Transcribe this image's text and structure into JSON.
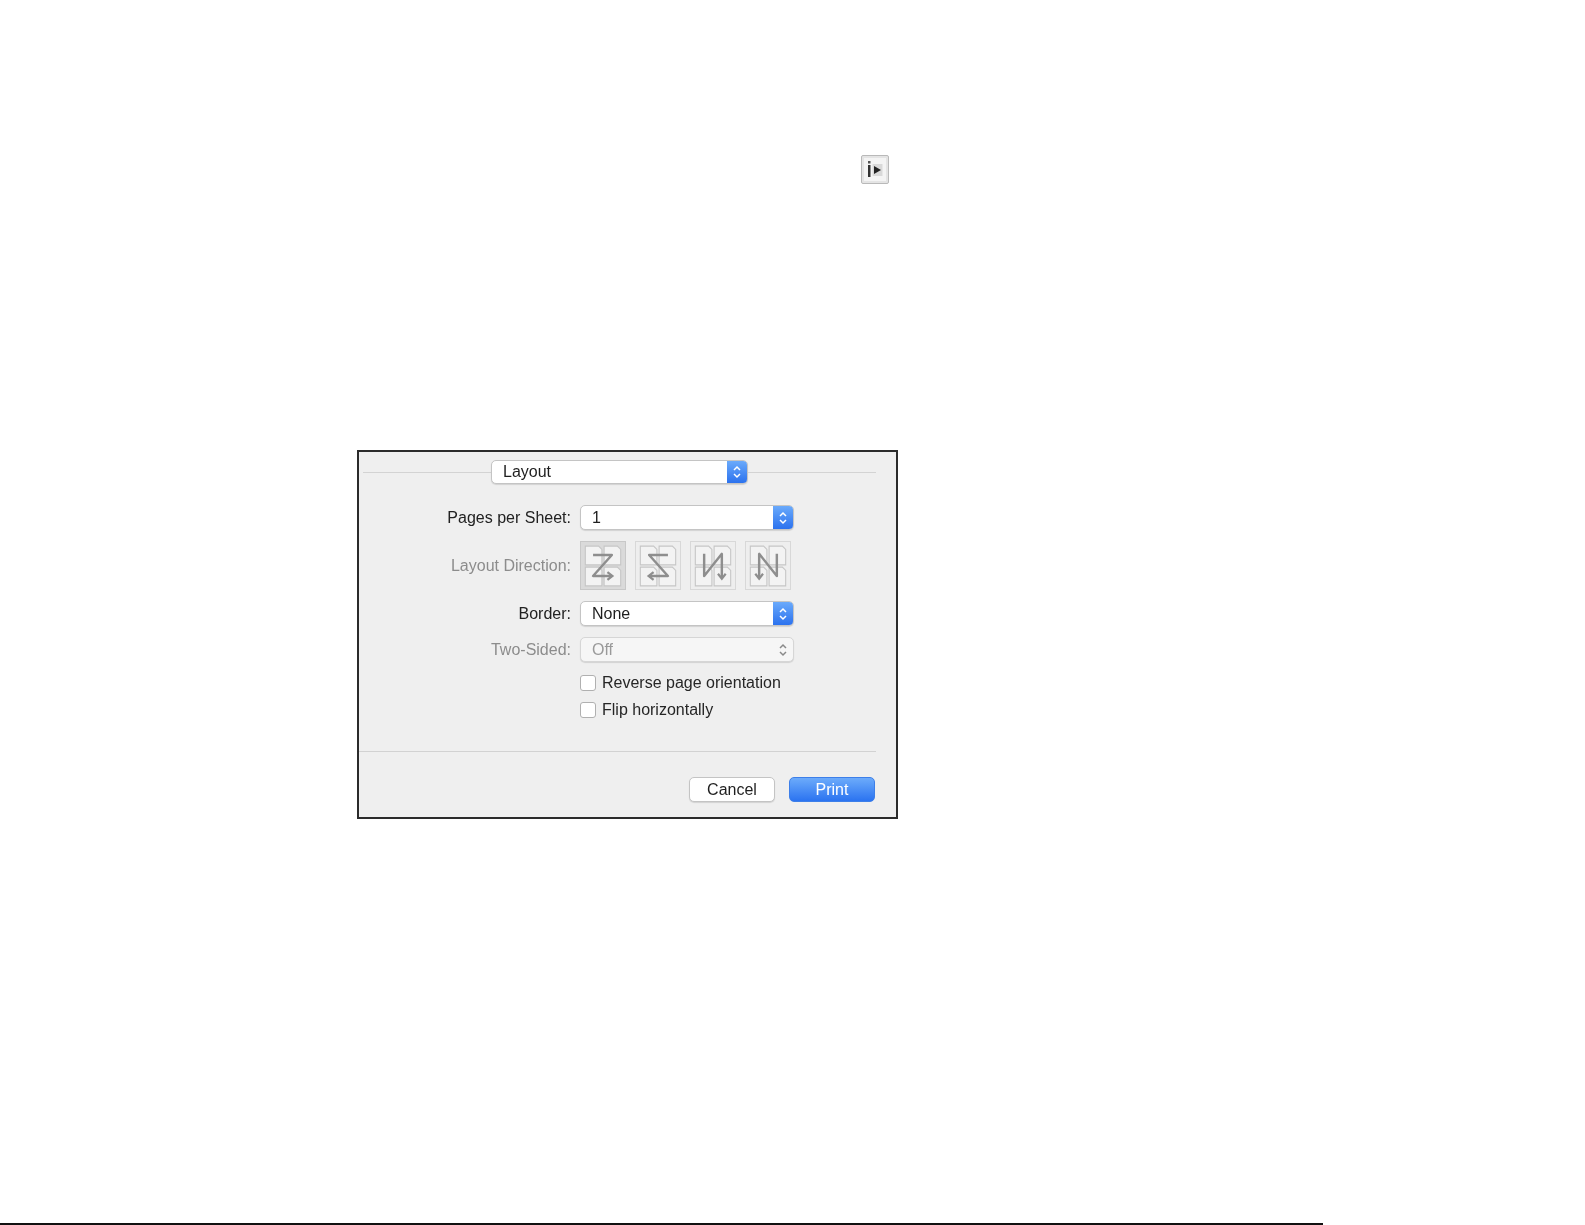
{
  "dialog": {
    "panel_menu": {
      "value": "Layout"
    },
    "settings": [
      {
        "kind": "popup",
        "label": "Pages per Sheet:",
        "value": "1",
        "disabled": false
      },
      {
        "kind": "direction",
        "label": "Layout Direction:",
        "disabled": true,
        "options": [
          {
            "kind": "z",
            "selected": true
          },
          {
            "kind": "reverse-z",
            "selected": false
          },
          {
            "kind": "reverse-n",
            "selected": false
          },
          {
            "kind": "n",
            "selected": false
          }
        ]
      },
      {
        "kind": "popup",
        "label": "Border:",
        "value": "None",
        "disabled": false
      },
      {
        "kind": "popup",
        "label": "Two-Sided:",
        "value": "Off",
        "disabled": true
      }
    ],
    "checkboxes": [
      {
        "label": "Reverse page orientation",
        "checked": false
      },
      {
        "label": "Flip horizontally",
        "checked": false
      }
    ],
    "buttons": [
      {
        "label": "Cancel",
        "kind": "secondary"
      },
      {
        "label": "Print",
        "kind": "default"
      }
    ]
  }
}
